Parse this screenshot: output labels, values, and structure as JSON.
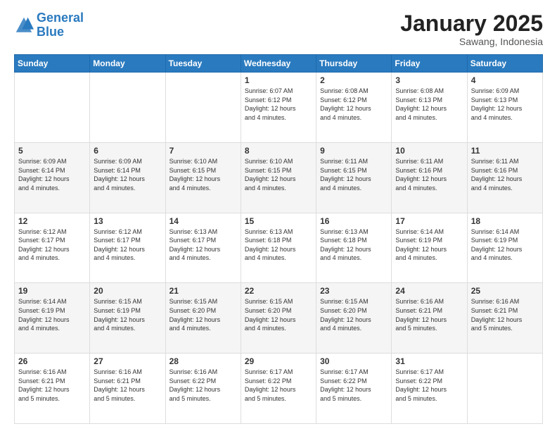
{
  "header": {
    "logo_line1": "General",
    "logo_line2": "Blue",
    "title": "January 2025",
    "subtitle": "Sawang, Indonesia"
  },
  "weekdays": [
    "Sunday",
    "Monday",
    "Tuesday",
    "Wednesday",
    "Thursday",
    "Friday",
    "Saturday"
  ],
  "weeks": [
    [
      {
        "day": "",
        "info": ""
      },
      {
        "day": "",
        "info": ""
      },
      {
        "day": "",
        "info": ""
      },
      {
        "day": "1",
        "info": "Sunrise: 6:07 AM\nSunset: 6:12 PM\nDaylight: 12 hours\nand 4 minutes."
      },
      {
        "day": "2",
        "info": "Sunrise: 6:08 AM\nSunset: 6:12 PM\nDaylight: 12 hours\nand 4 minutes."
      },
      {
        "day": "3",
        "info": "Sunrise: 6:08 AM\nSunset: 6:13 PM\nDaylight: 12 hours\nand 4 minutes."
      },
      {
        "day": "4",
        "info": "Sunrise: 6:09 AM\nSunset: 6:13 PM\nDaylight: 12 hours\nand 4 minutes."
      }
    ],
    [
      {
        "day": "5",
        "info": "Sunrise: 6:09 AM\nSunset: 6:14 PM\nDaylight: 12 hours\nand 4 minutes."
      },
      {
        "day": "6",
        "info": "Sunrise: 6:09 AM\nSunset: 6:14 PM\nDaylight: 12 hours\nand 4 minutes."
      },
      {
        "day": "7",
        "info": "Sunrise: 6:10 AM\nSunset: 6:15 PM\nDaylight: 12 hours\nand 4 minutes."
      },
      {
        "day": "8",
        "info": "Sunrise: 6:10 AM\nSunset: 6:15 PM\nDaylight: 12 hours\nand 4 minutes."
      },
      {
        "day": "9",
        "info": "Sunrise: 6:11 AM\nSunset: 6:15 PM\nDaylight: 12 hours\nand 4 minutes."
      },
      {
        "day": "10",
        "info": "Sunrise: 6:11 AM\nSunset: 6:16 PM\nDaylight: 12 hours\nand 4 minutes."
      },
      {
        "day": "11",
        "info": "Sunrise: 6:11 AM\nSunset: 6:16 PM\nDaylight: 12 hours\nand 4 minutes."
      }
    ],
    [
      {
        "day": "12",
        "info": "Sunrise: 6:12 AM\nSunset: 6:17 PM\nDaylight: 12 hours\nand 4 minutes."
      },
      {
        "day": "13",
        "info": "Sunrise: 6:12 AM\nSunset: 6:17 PM\nDaylight: 12 hours\nand 4 minutes."
      },
      {
        "day": "14",
        "info": "Sunrise: 6:13 AM\nSunset: 6:17 PM\nDaylight: 12 hours\nand 4 minutes."
      },
      {
        "day": "15",
        "info": "Sunrise: 6:13 AM\nSunset: 6:18 PM\nDaylight: 12 hours\nand 4 minutes."
      },
      {
        "day": "16",
        "info": "Sunrise: 6:13 AM\nSunset: 6:18 PM\nDaylight: 12 hours\nand 4 minutes."
      },
      {
        "day": "17",
        "info": "Sunrise: 6:14 AM\nSunset: 6:19 PM\nDaylight: 12 hours\nand 4 minutes."
      },
      {
        "day": "18",
        "info": "Sunrise: 6:14 AM\nSunset: 6:19 PM\nDaylight: 12 hours\nand 4 minutes."
      }
    ],
    [
      {
        "day": "19",
        "info": "Sunrise: 6:14 AM\nSunset: 6:19 PM\nDaylight: 12 hours\nand 4 minutes."
      },
      {
        "day": "20",
        "info": "Sunrise: 6:15 AM\nSunset: 6:19 PM\nDaylight: 12 hours\nand 4 minutes."
      },
      {
        "day": "21",
        "info": "Sunrise: 6:15 AM\nSunset: 6:20 PM\nDaylight: 12 hours\nand 4 minutes."
      },
      {
        "day": "22",
        "info": "Sunrise: 6:15 AM\nSunset: 6:20 PM\nDaylight: 12 hours\nand 4 minutes."
      },
      {
        "day": "23",
        "info": "Sunrise: 6:15 AM\nSunset: 6:20 PM\nDaylight: 12 hours\nand 4 minutes."
      },
      {
        "day": "24",
        "info": "Sunrise: 6:16 AM\nSunset: 6:21 PM\nDaylight: 12 hours\nand 5 minutes."
      },
      {
        "day": "25",
        "info": "Sunrise: 6:16 AM\nSunset: 6:21 PM\nDaylight: 12 hours\nand 5 minutes."
      }
    ],
    [
      {
        "day": "26",
        "info": "Sunrise: 6:16 AM\nSunset: 6:21 PM\nDaylight: 12 hours\nand 5 minutes."
      },
      {
        "day": "27",
        "info": "Sunrise: 6:16 AM\nSunset: 6:21 PM\nDaylight: 12 hours\nand 5 minutes."
      },
      {
        "day": "28",
        "info": "Sunrise: 6:16 AM\nSunset: 6:22 PM\nDaylight: 12 hours\nand 5 minutes."
      },
      {
        "day": "29",
        "info": "Sunrise: 6:17 AM\nSunset: 6:22 PM\nDaylight: 12 hours\nand 5 minutes."
      },
      {
        "day": "30",
        "info": "Sunrise: 6:17 AM\nSunset: 6:22 PM\nDaylight: 12 hours\nand 5 minutes."
      },
      {
        "day": "31",
        "info": "Sunrise: 6:17 AM\nSunset: 6:22 PM\nDaylight: 12 hours\nand 5 minutes."
      },
      {
        "day": "",
        "info": ""
      }
    ]
  ]
}
